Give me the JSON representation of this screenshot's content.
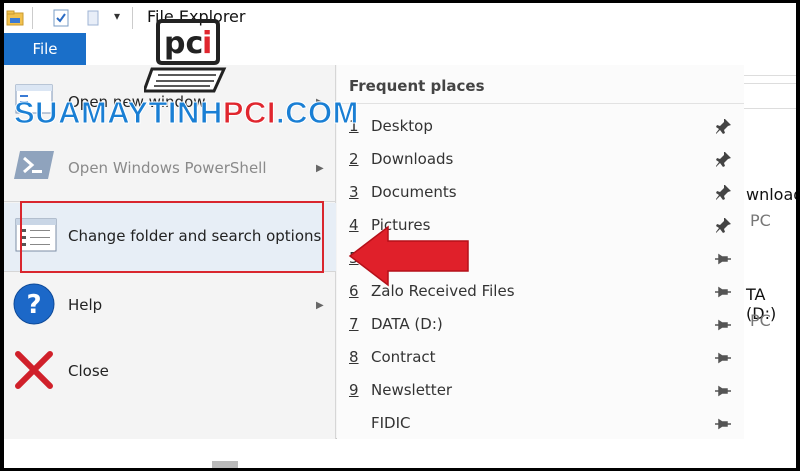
{
  "window": {
    "title": "File Explorer"
  },
  "file_tab": {
    "label": "File"
  },
  "menu": {
    "items": [
      {
        "label": "Open new window",
        "has_arrow": true
      },
      {
        "label": "Open Windows PowerShell",
        "has_arrow": true,
        "disabled": true
      },
      {
        "label": "Change folder and search options",
        "has_arrow": false
      },
      {
        "label": "Help",
        "has_arrow": true
      },
      {
        "label": "Close",
        "has_arrow": false
      }
    ]
  },
  "frequent_places": {
    "header": "Frequent places",
    "items": [
      {
        "num": "1",
        "name": "Desktop",
        "pinned": true
      },
      {
        "num": "2",
        "name": "Downloads",
        "pinned": true
      },
      {
        "num": "3",
        "name": "Documents",
        "pinned": true
      },
      {
        "num": "4",
        "name": "Pictures",
        "pinned": true
      },
      {
        "num": "5",
        "name": "",
        "pinned": false
      },
      {
        "num": "6",
        "name": "Zalo Received Files",
        "pinned": false
      },
      {
        "num": "7",
        "name": "DATA (D:)",
        "pinned": false
      },
      {
        "num": "8",
        "name": "Contract",
        "pinned": false
      },
      {
        "num": "9",
        "name": "Newsletter",
        "pinned": false
      },
      {
        "num": "",
        "name": "FIDIC",
        "pinned": false
      }
    ]
  },
  "background": {
    "downloads_text": "wnloads",
    "pc_text_1": "PC",
    "data_text": "TA (D:)",
    "pc_text_2": "PC"
  },
  "watermark": {
    "part1": "SUAMAYTINH",
    "part2": "PCI",
    "part3": ".COM",
    "color_blue": "#1a7fd4",
    "color_red": "#e0262e"
  },
  "colors": {
    "accent": "#1a6fc9",
    "highlight_red": "#d9262e",
    "arrow_red": "#e0202a"
  }
}
